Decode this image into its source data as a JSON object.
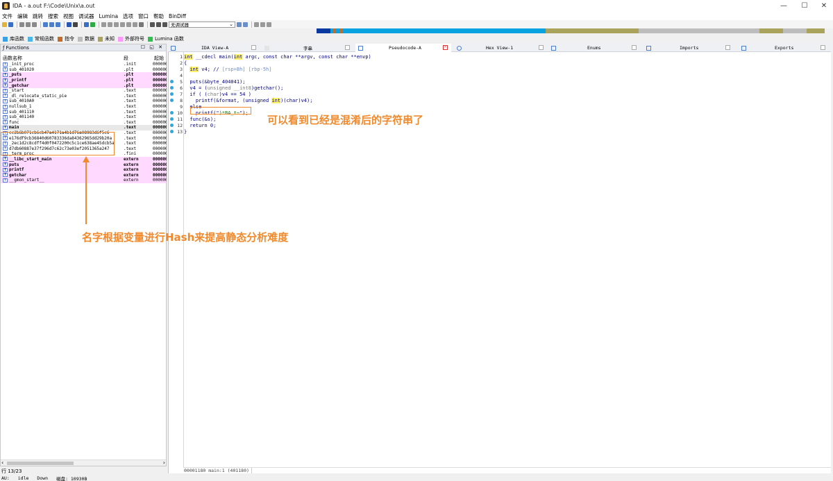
{
  "window": {
    "title": "IDA - a.out F:\\Code\\Unix\\a.out",
    "minimize": "—",
    "maximize": "☐",
    "close": "✕"
  },
  "menu": [
    "文件",
    "编辑",
    "跳转",
    "搜索",
    "视图",
    "调试器",
    "Lumina",
    "选项",
    "窗口",
    "帮助",
    "BinDiff"
  ],
  "toolbar": {
    "debugger_select": "无调试器"
  },
  "legend": [
    {
      "label": "库函数",
      "color": "#39a0e6"
    },
    {
      "label": "常规函数",
      "color": "#4ab7e6"
    },
    {
      "label": "指令",
      "color": "#c06c2c"
    },
    {
      "label": "数据",
      "color": "#bdbdbd"
    },
    {
      "label": "未知",
      "color": "#a9a35b"
    },
    {
      "label": "外部符号",
      "color": "#ff99ff"
    },
    {
      "label": "Lumina 函数",
      "color": "#2fbf4f"
    }
  ],
  "functions": {
    "title": "Functions",
    "col_name": "函数名称",
    "col_segment": "段",
    "col_start": "起始",
    "rows": [
      {
        "name": "_init_proc",
        "seg": ".init",
        "addr": "0000000",
        "style": ""
      },
      {
        "name": "sub_401020",
        "seg": ".plt",
        "addr": "0000000",
        "style": ""
      },
      {
        "name": "_puts",
        "seg": ".plt",
        "addr": "0000000",
        "style": "pink bold"
      },
      {
        "name": "_printf",
        "seg": ".plt",
        "addr": "0000000",
        "style": "pink bold"
      },
      {
        "name": "_getchar",
        "seg": ".plt",
        "addr": "0000000",
        "style": "pink bold"
      },
      {
        "name": "_start",
        "seg": ".text",
        "addr": "0000000",
        "style": ""
      },
      {
        "name": "_dl_relocate_static_pie",
        "seg": ".text",
        "addr": "0000000",
        "style": ""
      },
      {
        "name": "sub_4010A0",
        "seg": ".text",
        "addr": "0000000",
        "style": ""
      },
      {
        "name": "nullsub_1",
        "seg": ".text",
        "addr": "0000000",
        "style": ""
      },
      {
        "name": "sub_401110",
        "seg": ".text",
        "addr": "0000000",
        "style": ""
      },
      {
        "name": "sub_401140",
        "seg": ".text",
        "addr": "0000000",
        "style": ""
      },
      {
        "name": "func",
        "seg": ".text",
        "addr": "0000000",
        "style": ""
      },
      {
        "name": "main",
        "seg": ".text",
        "addr": "0000000",
        "style": "bold sel"
      },
      {
        "name": "cc2b6b071cb6cb47a4171a4b1d76a08983d6f5c6",
        "seg": ".text",
        "addr": "0000000",
        "style": ""
      },
      {
        "name": "e176df9cb36840d60783336da8436296​5dd29b20a",
        "seg": ".text",
        "addr": "0000000",
        "style": ""
      },
      {
        "name": "_2ec1d2c8cdff4d0f0472200c5c1ce638ae45dcb5a",
        "seg": ".text",
        "addr": "0000000",
        "style": ""
      },
      {
        "name": "d7db60887e37f296d7c62c73e03ef2051365a247",
        "seg": ".text",
        "addr": "0000000",
        "style": ""
      },
      {
        "name": "_term_proc",
        "seg": ".fini",
        "addr": "0000000",
        "style": ""
      },
      {
        "name": "__libc_start_main",
        "seg": "extern",
        "addr": "0000000",
        "style": "pink bold"
      },
      {
        "name": "puts",
        "seg": "extern",
        "addr": "0000000",
        "style": "pink bold"
      },
      {
        "name": "printf",
        "seg": "extern",
        "addr": "0000000",
        "style": "pink bold"
      },
      {
        "name": "getchar",
        "seg": "extern",
        "addr": "0000000",
        "style": "pink bold"
      },
      {
        "name": "__gmon_start__",
        "seg": "extern",
        "addr": "0000000",
        "style": "pink"
      }
    ],
    "row_info": "行 13/23"
  },
  "tabs": [
    {
      "label": "IDA View-A",
      "active": false
    },
    {
      "label": "字串",
      "active": false
    },
    {
      "label": "Pseudocode-A",
      "active": true
    },
    {
      "label": "Hex View-1",
      "active": false
    },
    {
      "label": "Enums",
      "active": false
    },
    {
      "label": "Imports",
      "active": false
    },
    {
      "label": "Exports",
      "active": false
    }
  ],
  "code": {
    "lines": [
      {
        "n": "1",
        "dot": false,
        "html": "<span class='kw'>int</span> __cdecl main(<span class='kw'>int</span> argc, const char **argv, const char **envp)"
      },
      {
        "n": "2",
        "dot": false,
        "html": "{"
      },
      {
        "n": "3",
        "dot": false,
        "html": "  <span class='kw'>int</span> v4; // <span class='cm'>[rsp+Bh] [rbp-5h]</span>"
      },
      {
        "n": "4",
        "dot": false,
        "html": ""
      },
      {
        "n": "5",
        "dot": true,
        "html": "  puts(&byte_404041);"
      },
      {
        "n": "6",
        "dot": true,
        "html": "  v4 = (<span class='gr'>unsigned __int8</span>)getchar();"
      },
      {
        "n": "7",
        "dot": true,
        "html": "  if ( (<span class='gr'>char</span>)v4 == 54 )"
      },
      {
        "n": "8",
        "dot": true,
        "html": "    printf(&format, (unsigned <span class='kw'>int</span>)(char)v4);"
      },
      {
        "n": "9",
        "dot": false,
        "html": "  else"
      },
      {
        "n": "10",
        "dot": true,
        "html": "    printf(\"<span class='str'>)*BA_t~</span>\");"
      },
      {
        "n": "11",
        "dot": true,
        "html": "  func(&s);"
      },
      {
        "n": "12",
        "dot": true,
        "html": "  return 0;"
      },
      {
        "n": "13",
        "dot": true,
        "html": "}"
      }
    ],
    "status": "00001180 main:1 (401180)"
  },
  "annotations": {
    "right": "可以看到已经是混淆后的字符串了",
    "left": "名字根据变量进行Hash来提高静态分析难度"
  },
  "status": {
    "au": "AU:",
    "state": "idle",
    "dir": "Down",
    "disk": "磁盘: 10930B"
  }
}
